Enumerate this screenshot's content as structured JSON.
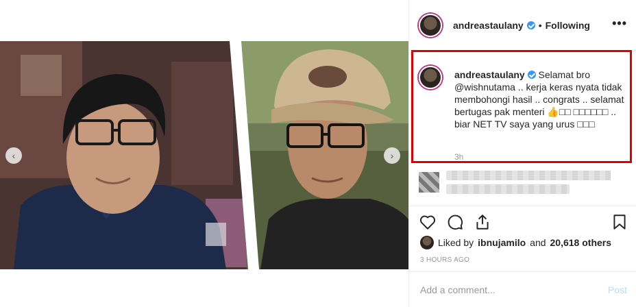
{
  "post": {
    "author": "andreastaulany",
    "follow_separator": "•",
    "follow_status": "Following",
    "more_icon": "more-horizontal-icon",
    "verified_icon": "verified-badge-icon"
  },
  "caption": {
    "username": "andreastaulany",
    "text": "Selamat bro @wishnutama .. kerja keras nyata tidak membohongi hasil .. congrats .. selamat bertugas pak menteri 👍□□ □□□□□□ .. biar NET TV saya yang urus □□□",
    "time_ago": "3h"
  },
  "actions": {
    "like_icon": "heart-icon",
    "comment_icon": "comment-icon",
    "share_icon": "share-icon",
    "save_icon": "bookmark-icon"
  },
  "likes": {
    "prefix": "Liked by",
    "liker": "ibnujamilo",
    "connector": "and",
    "others": "20,618 others"
  },
  "timestamp": "3 HOURS AGO",
  "comment_box": {
    "placeholder": "Add a comment...",
    "post_label": "Post"
  },
  "carousel": {
    "prev_icon": "chevron-left-icon",
    "next_icon": "chevron-right-icon",
    "slide_count": 3,
    "active_slide": 2
  },
  "colors": {
    "highlight_border": "#e00000",
    "accent": "#3897f0",
    "muted": "#999999"
  }
}
